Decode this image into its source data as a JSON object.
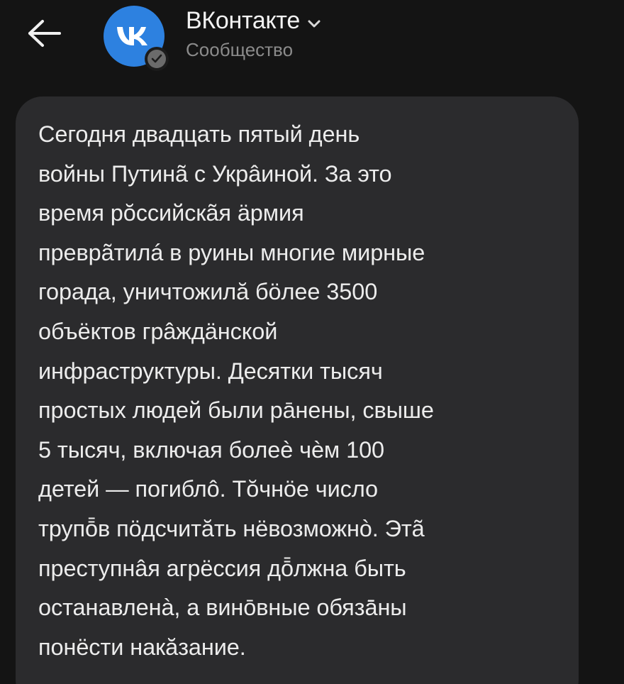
{
  "header": {
    "back_icon": "arrow-left-icon",
    "avatar_icon": "vk-logo-icon",
    "verified_icon": "check-badge-icon",
    "title": "ВКонтакте",
    "title_chevron_icon": "chevron-down-icon",
    "subtitle": "Сообщество"
  },
  "message": {
    "text": "Сегодня двадцать пятый день\nвойны Путинã с Укрâиной. За это\nвремя рŏссийскãя äрмия\nпревpãтилá в руины многие мирные\nгорада, уничтожилă бöлее 3500\nобъёктов грâждäнской\nинфраструктуры. Десятки тысяч\nпростых людей были рāнены, свыше\n5 тысяч, включая болеè чѐм 100\nдетей — погиблô. Тŏчнöе число\nтрупō̄в пöдсчитăть нёвозможнò. Этã\nпреступнâя агрёссия дō̄лжна быть\nостанавленà, а винōвные обязā̄ны\nпонёсти накăзание."
  },
  "colors": {
    "background": "#141414",
    "bubble": "#2b2b2d",
    "text": "#ececec",
    "subtitle": "#8b8b8b",
    "vk_blue": "#2d81e0"
  }
}
